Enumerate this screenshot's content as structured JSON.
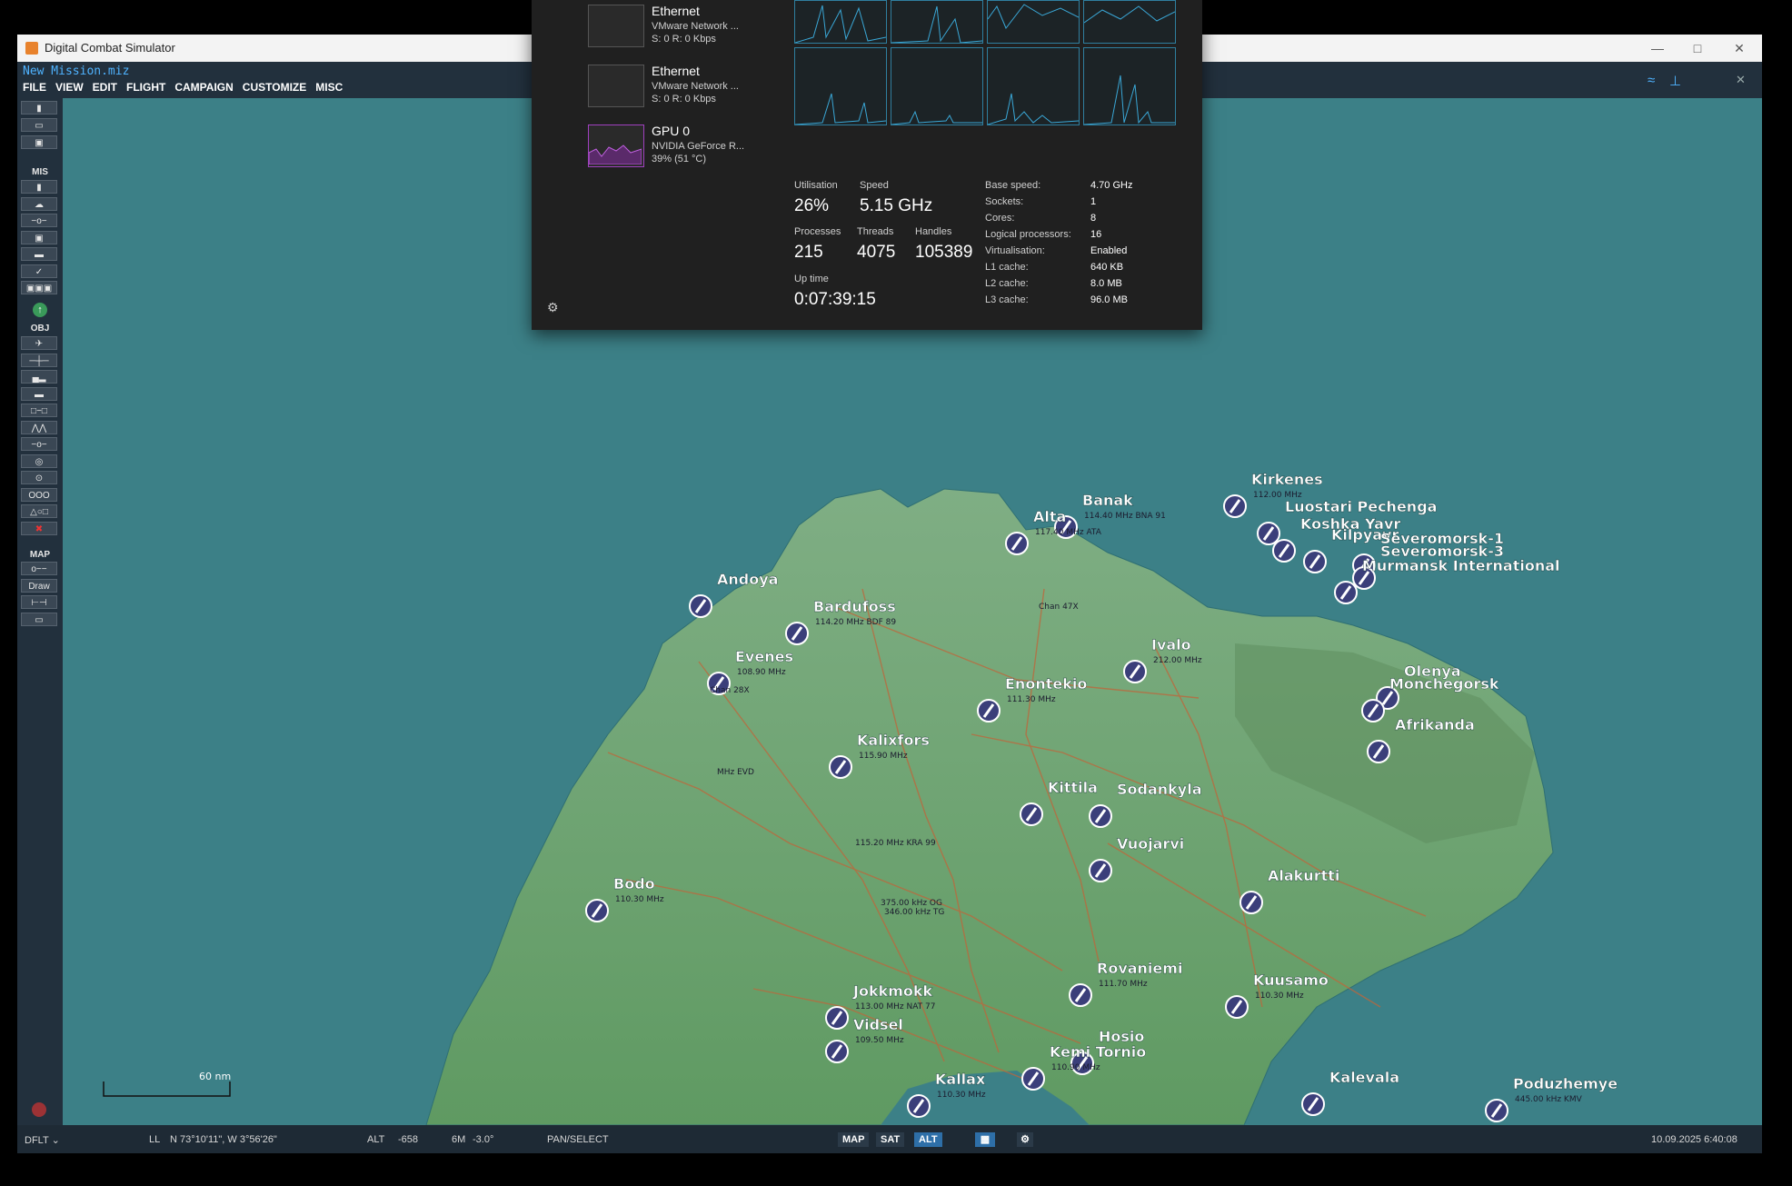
{
  "window": {
    "title": "Digital Combat Simulator",
    "minimize_icon": "minimize-icon",
    "maximize_icon": "maximize-icon",
    "close_icon": "close-icon"
  },
  "menubar": {
    "mission_name": "New Mission.miz",
    "items": [
      "FILE",
      "VIEW",
      "EDIT",
      "FLIGHT",
      "CAMPAIGN",
      "CUSTOMIZE",
      "MISC"
    ]
  },
  "sidebar": {
    "sections": [
      "MIS",
      "OBJ",
      "MAP"
    ],
    "draw_label": "Draw"
  },
  "map": {
    "scale_label": "60 nm",
    "airfields": [
      {
        "name": "Banak",
        "freq": "114.40 MHz BNA 91"
      },
      {
        "name": "Alta",
        "freq": "117.40 MHz ATA"
      },
      {
        "name": "Kirkenes",
        "freq": "112.00 MHz"
      },
      {
        "name": "Luostari Pechenga",
        "freq": ""
      },
      {
        "name": "Koshka Yavr",
        "freq": ""
      },
      {
        "name": "Kilpyavr",
        "freq": ""
      },
      {
        "name": "Severomorsk-1",
        "freq": ""
      },
      {
        "name": "Severomorsk-3",
        "freq": ""
      },
      {
        "name": "Murmansk International",
        "freq": ""
      },
      {
        "name": "Andoya",
        "freq": ""
      },
      {
        "name": "Bardufoss",
        "freq": "114.20 MHz BDF 89"
      },
      {
        "name": "Evenes",
        "freq": "108.90 MHz"
      },
      {
        "name": "Ivalo",
        "freq": "212.00 MHz"
      },
      {
        "name": "Enontekio",
        "freq": "111.30 MHz"
      },
      {
        "name": "Olenya",
        "freq": ""
      },
      {
        "name": "Monchegorsk",
        "freq": ""
      },
      {
        "name": "Afrikanda",
        "freq": ""
      },
      {
        "name": "Kalixfors",
        "freq": "115.90 MHz"
      },
      {
        "name": "Kittila",
        "freq": ""
      },
      {
        "name": "Sodankyla",
        "freq": ""
      },
      {
        "name": "Vuojarvi",
        "freq": ""
      },
      {
        "name": "Alakurtti",
        "freq": ""
      },
      {
        "name": "Bodo",
        "freq": "110.30 MHz"
      },
      {
        "name": "Rovaniemi",
        "freq": "111.70 MHz"
      },
      {
        "name": "Jokkmokk",
        "freq": "113.00 MHz NAT 77"
      },
      {
        "name": "Kuusamo",
        "freq": "110.30 MHz"
      },
      {
        "name": "Vidsel",
        "freq": "109.50 MHz"
      },
      {
        "name": "Hosio",
        "freq": ""
      },
      {
        "name": "Kemi Tornio",
        "freq": "110.90 MHz"
      },
      {
        "name": "Kallax",
        "freq": "110.30 MHz"
      },
      {
        "name": "Kalevala",
        "freq": ""
      },
      {
        "name": "Poduzhemye",
        "freq": "445.00 kHz KMV"
      }
    ],
    "extra_labels": {
      "ndb_tg": "375.00 kHz OG",
      "ndb_tg2": "346.00 kHz TG",
      "kra": "115.20 MHz KRA 99",
      "evd": "MHz EVD",
      "bdf_chan": "Chan 28X",
      "chan47": "Chan 47X"
    }
  },
  "statusbar": {
    "profile": "DFLT",
    "coord_mode": "LL",
    "coords": "N 73°10'11\", W  3°56'26\"",
    "alt_label": "ALT",
    "alt_value": "-658",
    "mag_label": "6M",
    "mag_value": "-3.0°",
    "mode": "PAN/SELECT",
    "map_btn": "MAP",
    "sat_btn": "SAT",
    "alt_btn": "ALT",
    "datetime": "10.09.2025 6:40:08"
  },
  "task_manager": {
    "devices": [
      {
        "name": "Ethernet",
        "sub1": "VMware Network ...",
        "sub2": "S: 0 R: 0 Kbps"
      },
      {
        "name": "Ethernet",
        "sub1": "VMware Network ...",
        "sub2": "S: 0 R: 0 Kbps"
      },
      {
        "name": "GPU 0",
        "sub1": "NVIDIA GeForce R...",
        "sub2": "39% (51 °C)"
      }
    ],
    "stats": {
      "utilisation_label": "Utilisation",
      "utilisation": "26%",
      "speed_label": "Speed",
      "speed": "5.15 GHz",
      "processes_label": "Processes",
      "processes": "215",
      "threads_label": "Threads",
      "threads": "4075",
      "handles_label": "Handles",
      "handles": "105389",
      "uptime_label": "Up time",
      "uptime": "0:07:39:15"
    },
    "specs": [
      {
        "k": "Base speed:",
        "v": "4.70 GHz"
      },
      {
        "k": "Sockets:",
        "v": "1"
      },
      {
        "k": "Cores:",
        "v": "8"
      },
      {
        "k": "Logical processors:",
        "v": "16"
      },
      {
        "k": "Virtualisation:",
        "v": "Enabled"
      },
      {
        "k": "L1 cache:",
        "v": "640 KB"
      },
      {
        "k": "L2 cache:",
        "v": "8.0 MB"
      },
      {
        "k": "L3 cache:",
        "v": "96.0 MB"
      }
    ]
  }
}
